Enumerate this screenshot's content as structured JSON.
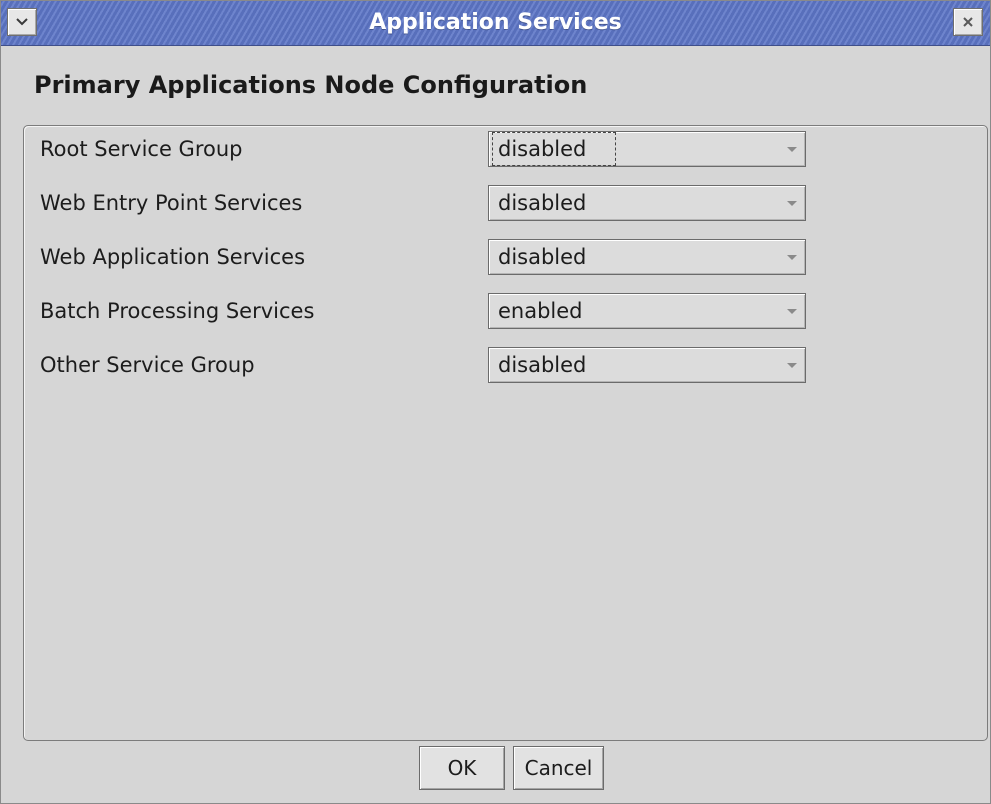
{
  "window": {
    "title": "Application Services"
  },
  "titlebar_icons": {
    "menu": "chevron-down-icon",
    "close": "close-icon"
  },
  "heading": "Primary Applications Node Configuration",
  "rows": [
    {
      "label": "Root Service Group",
      "value": "disabled",
      "focused": true
    },
    {
      "label": "Web Entry Point Services",
      "value": "disabled",
      "focused": false
    },
    {
      "label": "Web Application Services",
      "value": "disabled",
      "focused": false
    },
    {
      "label": "Batch Processing Services",
      "value": "enabled",
      "focused": false
    },
    {
      "label": "Other Service Group",
      "value": "disabled",
      "focused": false
    }
  ],
  "buttons": {
    "ok": "OK",
    "cancel": "Cancel"
  },
  "colors": {
    "titlebar": "#5d76c7",
    "background": "#d6d6d6"
  }
}
